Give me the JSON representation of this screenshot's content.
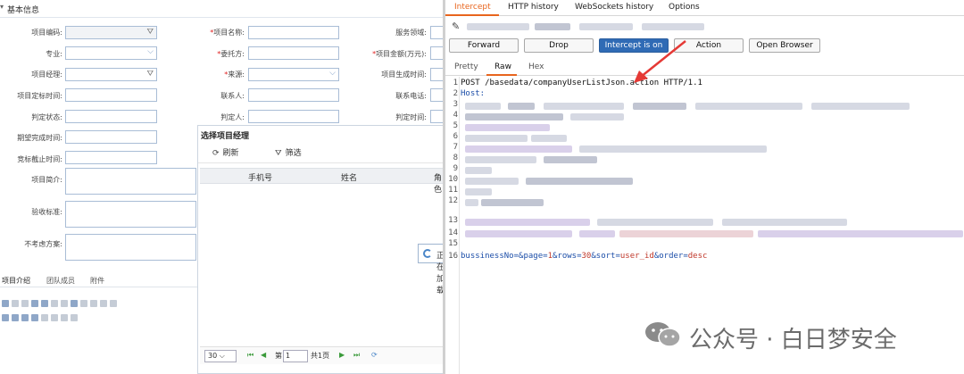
{
  "left_panel": {
    "section_title": "基本信息",
    "fields": [
      {
        "label": "项目编码:",
        "required": false
      },
      {
        "label": "项目名称:",
        "required": true
      },
      {
        "label": "服务领域:",
        "required": false
      },
      {
        "label": "专业:",
        "required": false
      },
      {
        "label": "委托方:",
        "required": true
      },
      {
        "label": "项目金额(万元):",
        "required": true
      },
      {
        "label": "项目经理:",
        "required": false
      },
      {
        "label": "来源:",
        "required": true
      },
      {
        "label": "项目生成时间:",
        "required": false
      },
      {
        "label": "项目定标时间:",
        "required": false
      },
      {
        "label": "联系人:",
        "required": false
      },
      {
        "label": "联系电话:",
        "required": false
      },
      {
        "label": "判定状态:",
        "required": false
      },
      {
        "label": "判定人:",
        "required": false
      },
      {
        "label": "判定时间:",
        "required": false
      },
      {
        "label": "期望完成时间:",
        "required": false
      },
      {
        "label": "竞标截止时间:",
        "required": false
      },
      {
        "label": "项目简介:",
        "required": false
      },
      {
        "label": "验收标准:",
        "required": false
      },
      {
        "label": "不考虑方案:",
        "required": false
      }
    ],
    "tabs": [
      "项目介绍",
      "团队成员",
      "附件"
    ]
  },
  "dialog": {
    "title": "选择项目经理",
    "refresh_label": "刷新",
    "filter_label": "筛选",
    "columns": [
      "手机号",
      "姓名",
      "角色"
    ],
    "loading_text": "正在加载",
    "pager": {
      "page_size": "30",
      "page_prefix": "第",
      "page_value": "1",
      "page_total": "共1页"
    }
  },
  "burp": {
    "tabs": [
      "Intercept",
      "HTTP history",
      "WebSockets history",
      "Options"
    ],
    "active_tab": "Intercept",
    "buttons": {
      "forward": "Forward",
      "drop": "Drop",
      "intercept": "Intercept is on",
      "action": "Action",
      "open_browser": "Open Browser"
    },
    "view_tabs": [
      "Pretty",
      "Raw",
      "Hex"
    ],
    "active_view": "Raw",
    "request_line": "POST /basedata/companyUserListJson.action HTTP/1.1",
    "host_label": "Host:",
    "body_param_names": [
      "bussinessNo",
      "page",
      "rows",
      "sort",
      "order"
    ],
    "body_param_values": [
      "",
      "1",
      "30",
      "user_id",
      "desc"
    ],
    "line_numbers": [
      "1",
      "2",
      "3",
      "4",
      "5",
      "6",
      "7",
      "8",
      "9",
      "10",
      "11",
      "12",
      "13",
      "14",
      "15",
      "16"
    ]
  },
  "watermark": {
    "text": "公众号 · 白日梦安全"
  },
  "colors": {
    "accent_orange": "#e8651e",
    "intercept_blue": "#2f6bb5",
    "arrow_red": "#e53935"
  }
}
